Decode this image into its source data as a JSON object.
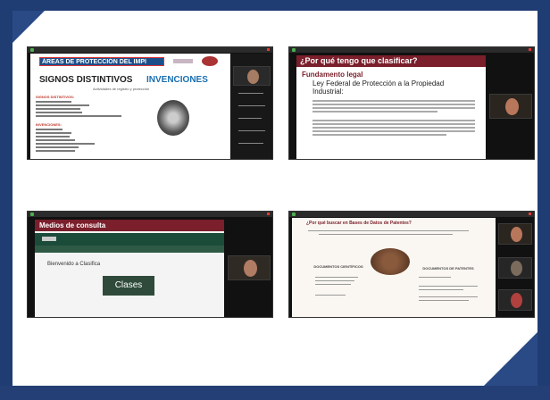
{
  "slide1": {
    "header": "ÁREAS DE PROTECCIÓN DEL IMPI",
    "title_left": "SIGNOS DISTINTIVOS",
    "title_right": "INVENCIONES",
    "subtitle": "Actividades de registro y protección",
    "list1_title": "SIGNOS DISTINTIVOS:",
    "list2_title": "INVENCIONES:"
  },
  "slide2": {
    "header": "¿Por qué tengo que clasificar?",
    "subheader": "Fundamento legal",
    "law_title": "Ley Federal de Protección a la Propiedad Industrial:"
  },
  "slide3": {
    "header": "Medios de consulta",
    "greeting": "Bienvenido a Clasifica",
    "button": "Clases"
  },
  "slide4": {
    "header": "¿Por qué buscar en Bases de Datos de Patentes?",
    "left_label": "DOCUMENTOS CIENTÍFICOS",
    "right_label": "DOCUMENTOS DE PATENTES"
  },
  "colors": {
    "brand_navy": "#1f3c73",
    "header_maroon": "#7a1f2b",
    "teal": "#0a7a8a",
    "clases_green": "#2f4a3b"
  }
}
